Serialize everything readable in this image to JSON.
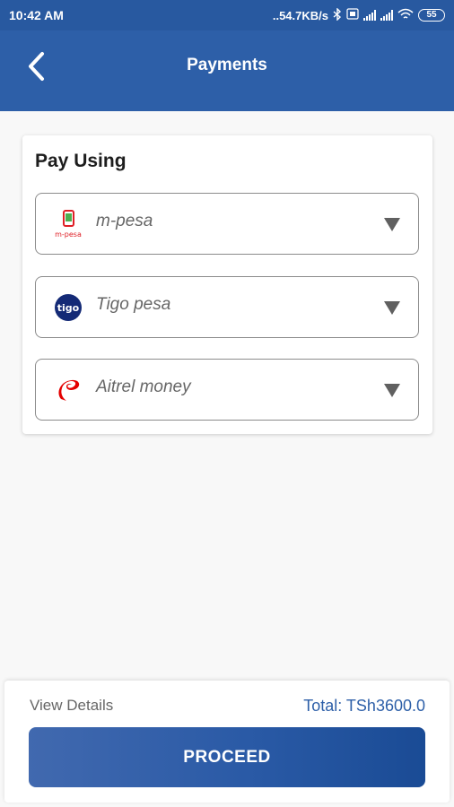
{
  "status_bar": {
    "time": "10:42 AM",
    "network_speed": "54.7KB/s",
    "battery": "55"
  },
  "header": {
    "title": "Payments",
    "back_icon": "chevron-left-icon"
  },
  "payment_card": {
    "title": "Pay Using",
    "options": [
      {
        "label": "m-pesa",
        "icon": "m-pesa-logo",
        "icon_text": "m-pesa"
      },
      {
        "label": "Tigo pesa",
        "icon": "tigo-logo",
        "icon_text": "tigo"
      },
      {
        "label": "Aitrel money",
        "icon": "airtel-logo"
      }
    ]
  },
  "summary": {
    "view_details": "View Details",
    "total": "Total: TSh3600.0",
    "proceed": "PROCEED"
  },
  "colors": {
    "primary": "#2d5fa8",
    "status_bar": "#2859a0",
    "mpesa_red": "#df1f26",
    "mpesa_green": "#4caf50",
    "tigo_navy": "#142a76",
    "airtel_red": "#e40000"
  }
}
